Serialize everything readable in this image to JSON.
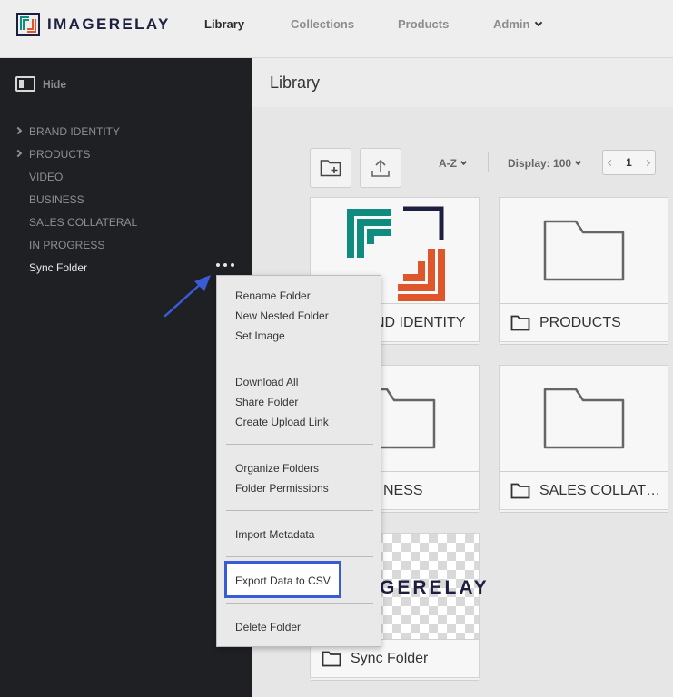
{
  "app": {
    "brand": "IMAGERELAY",
    "brand_colors": {
      "teal": "#0f8c7f",
      "orange": "#e0562b",
      "navy": "#1c1f3f"
    }
  },
  "nav": {
    "library": "Library",
    "collections": "Collections",
    "products": "Products",
    "admin": "Admin"
  },
  "sidebar": {
    "hide_label": "Hide",
    "folders": [
      {
        "label": "BRAND IDENTITY",
        "expandable": true
      },
      {
        "label": "PRODUCTS",
        "expandable": true
      },
      {
        "label": "VIDEO",
        "expandable": false
      },
      {
        "label": "BUSINESS",
        "expandable": false
      },
      {
        "label": "SALES COLLATERAL",
        "expandable": false
      },
      {
        "label": "IN PROGRESS",
        "expandable": false
      },
      {
        "label": "Sync Folder",
        "expandable": false,
        "selected": true
      }
    ]
  },
  "main": {
    "title": "Library",
    "sort_label": "A-Z",
    "display_label": "Display: 100",
    "page_number": "1"
  },
  "cards": [
    {
      "label": "BRAND IDENTITY",
      "visible_label": "ND IDENTITY"
    },
    {
      "label": "PRODUCTS"
    },
    {
      "label": "BUSINESS",
      "visible_label": "NESS"
    },
    {
      "label": "SALES COLLATER..."
    },
    {
      "label": "Sync Folder",
      "watermark": "GERELAY"
    }
  ],
  "context_menu": {
    "group1": [
      "Rename Folder",
      "New Nested Folder",
      "Set Image"
    ],
    "group2": [
      "Download All",
      "Share Folder",
      "Create Upload Link"
    ],
    "group3": [
      "Organize Folders",
      "Folder Permissions"
    ],
    "group4": [
      "Import Metadata"
    ],
    "group5": [
      "Export Data to CSV"
    ],
    "group6": [
      "Delete Folder"
    ],
    "highlight_color": "#3a5bd6"
  }
}
